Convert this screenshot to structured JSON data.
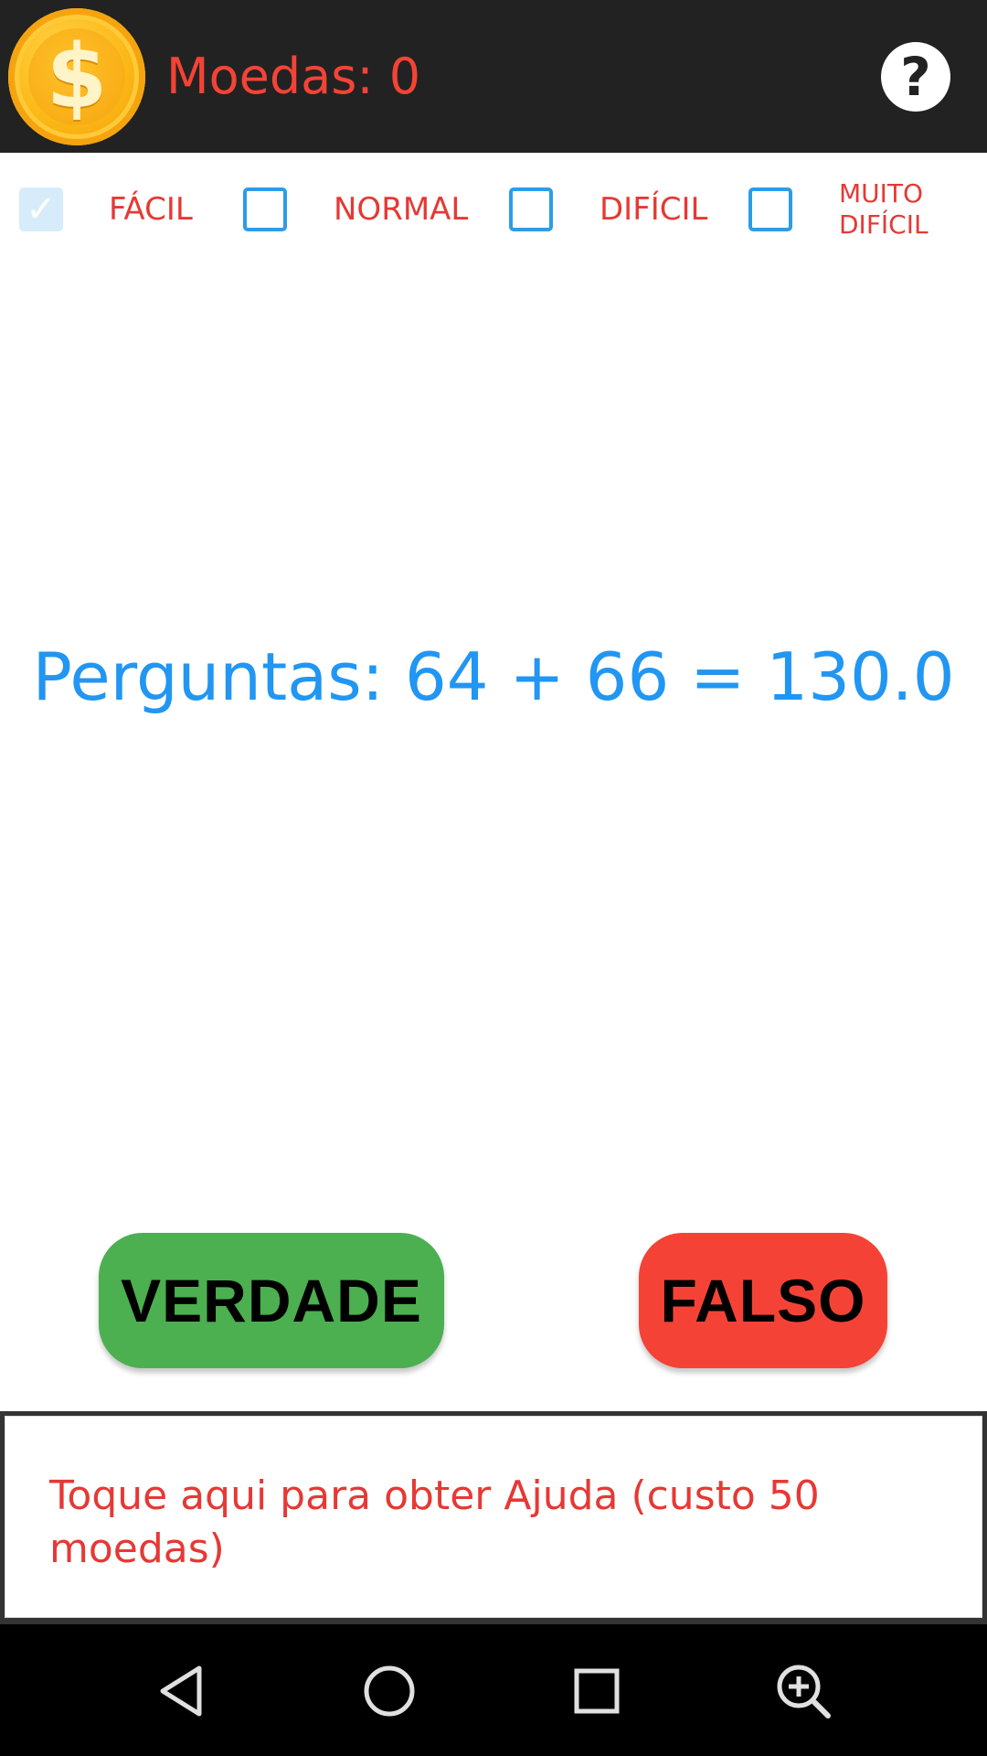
{
  "header": {
    "coin_symbol": "$",
    "coins_label": "Moedas: 0",
    "help_symbol": "?",
    "icons": {
      "coin": "coin-icon",
      "help": "help-icon"
    }
  },
  "difficulty": {
    "options": [
      {
        "label": "FÁCIL",
        "checked": true
      },
      {
        "label": "NORMAL",
        "checked": false
      },
      {
        "label": "DIFÍCIL",
        "checked": false
      },
      {
        "label": "MUITO DIFÍCIL",
        "checked": false
      }
    ]
  },
  "question": {
    "text": "Perguntas: 64 + 66  = 130.0"
  },
  "answers": {
    "true_label": "VERDADE",
    "false_label": "FALSO"
  },
  "help_banner": {
    "text": "Toque aqui para obter Ajuda (custo 50 moedas)"
  },
  "navbar": {
    "icons": [
      "back-icon",
      "home-icon",
      "recents-icon",
      "magnify-icon"
    ]
  },
  "colors": {
    "header_bg": "#222222",
    "accent_red": "#f44336",
    "accent_blue": "#2196f3",
    "true_green": "#4caf50",
    "false_red": "#f44336"
  }
}
